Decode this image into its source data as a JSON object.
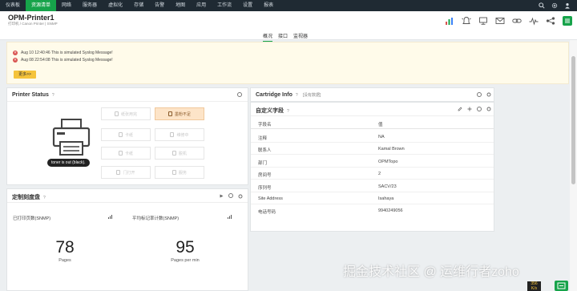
{
  "nav": {
    "items": [
      "仪表板",
      "资源清单",
      "网络",
      "服务器",
      "虚拟化",
      "存储",
      "告警",
      "地图",
      "应用",
      "工作流",
      "设置",
      "报表"
    ],
    "active_index": 1
  },
  "device": {
    "name": "OPM-Printer1",
    "breadcrumb": "打印机 / Canon Printer | SNMP"
  },
  "tabs": [
    "概况",
    "接口",
    "监视器"
  ],
  "active_tab": 0,
  "syslog": {
    "messages": [
      "Aug 10 12:40:46 This is simulated Syslog Message!",
      "Aug 08 22:54:08 This is simulated Syslog Message!"
    ],
    "more_label": "更多>>"
  },
  "printer_status": {
    "title": "Printer Status",
    "help": "?",
    "tooltip": "toner is out (black).",
    "buttons": [
      {
        "label": "纸张用完",
        "warn": false
      },
      {
        "label": "墨粉不足",
        "warn": true
      },
      {
        "label": "卡纸",
        "warn": false
      },
      {
        "label": "维修中",
        "warn": false
      },
      {
        "label": "卡纸",
        "warn": false
      },
      {
        "label": "脱机",
        "warn": false
      },
      {
        "label": "门打开",
        "warn": false
      },
      {
        "label": "服务",
        "warn": false
      }
    ]
  },
  "gauge_panel": {
    "title": "定制刻度盘",
    "help": "?",
    "gauges": [
      {
        "label": "已打印页数(SNMP)",
        "value": "78",
        "unit": "Pages"
      },
      {
        "label": "平均标记率计数(SNMP)",
        "value": "95",
        "unit": "Pages per min"
      }
    ]
  },
  "cartridge": {
    "title": "Cartridge Info",
    "help": "?",
    "subtitle": "[没有数据]"
  },
  "custom_fields": {
    "title": "自定义字段",
    "help": "?",
    "header": [
      "字段名",
      "值"
    ],
    "rows": [
      [
        "注释",
        "NA"
      ],
      [
        "联系人",
        "Kamal Brown"
      ],
      [
        "部门",
        "OPMTopo"
      ],
      [
        "房间号",
        "2"
      ],
      [
        "序列号",
        "SACV/23"
      ],
      [
        "Site Address",
        "Isahaya"
      ],
      [
        "电话号码",
        "9940249056"
      ]
    ]
  },
  "watermark": "掘金技术社区 @ 运维行者zoho",
  "badge": {
    "line1": "356",
    "line2": "K/s"
  },
  "colors": {
    "accent": "#16a34a",
    "nav_bg": "#1f2a33",
    "warn": "#fde4c8",
    "banner": "#fffbea",
    "more_button": "#f5c33b"
  }
}
